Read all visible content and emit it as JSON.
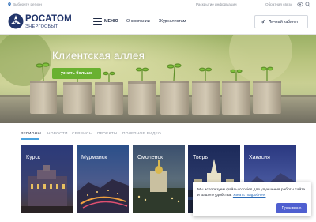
{
  "topbar": {
    "region": "Выберите регион",
    "disclosure": "Раскрытие информации",
    "feedback": "Обратная связь",
    "icons": [
      "location-pin-icon",
      "eye-icon",
      "search-icon"
    ]
  },
  "header": {
    "logo_title": "РОСАТОМ",
    "logo_subtitle": "ЭНЕРГОСБЫТ",
    "menu_label": "МЕНЮ",
    "nav": [
      "О компании",
      "Журналистам"
    ],
    "cabinet": "Личный кабинет"
  },
  "hero": {
    "title": "Клиентская аллея",
    "button": "узнать больше"
  },
  "tabs": {
    "items": [
      "РЕГИОНЫ",
      "НОВОСТИ",
      "СЕРВИСЫ",
      "ПРОЕКТЫ",
      "ПОЛЕЗНОЕ ВИДЕО"
    ],
    "active": "РЕГИОНЫ"
  },
  "regions": [
    "Курск",
    "Мурманск",
    "Смоленск",
    "Тверь",
    "Хакасия"
  ],
  "cookie": {
    "text": "Мы используем файлы cookies для улучшения работы сайта и Вашего удобства.",
    "link": "Узнать подробнее.",
    "button": "Принимаю"
  },
  "colors": {
    "brand_navy": "#22356b",
    "accent_green": "#69b130",
    "tab_underline": "#4aa3df",
    "cookie_button": "#4f5fd0"
  }
}
